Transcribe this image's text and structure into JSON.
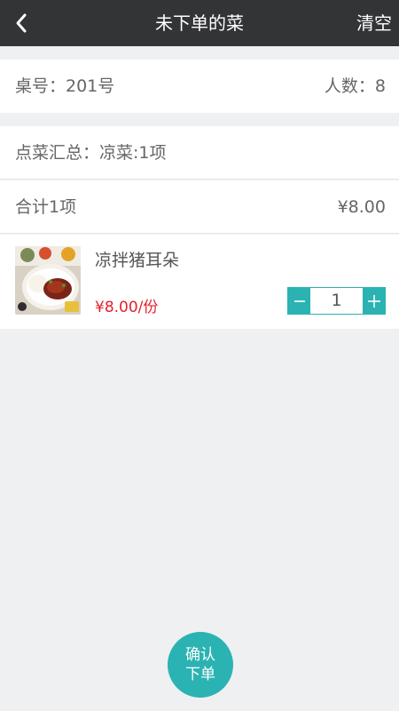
{
  "header": {
    "title": "未下单的菜",
    "clear_label": "清空",
    "back_icon": "chevron-left-icon"
  },
  "table_info": {
    "table_no": "桌号：201号",
    "people": "人数：8"
  },
  "summary": {
    "text": "点菜汇总：凉菜:1项"
  },
  "total": {
    "label": "合计1项",
    "amount": "¥8.00"
  },
  "dishes": [
    {
      "name": "凉拌猪耳朵",
      "price": "¥8.00/份",
      "quantity": "1"
    }
  ],
  "confirm": {
    "line1": "确认",
    "line2": "下单"
  },
  "colors": {
    "accent": "#2ab3b2",
    "price": "#e4212b",
    "titlebar": "#333436"
  }
}
